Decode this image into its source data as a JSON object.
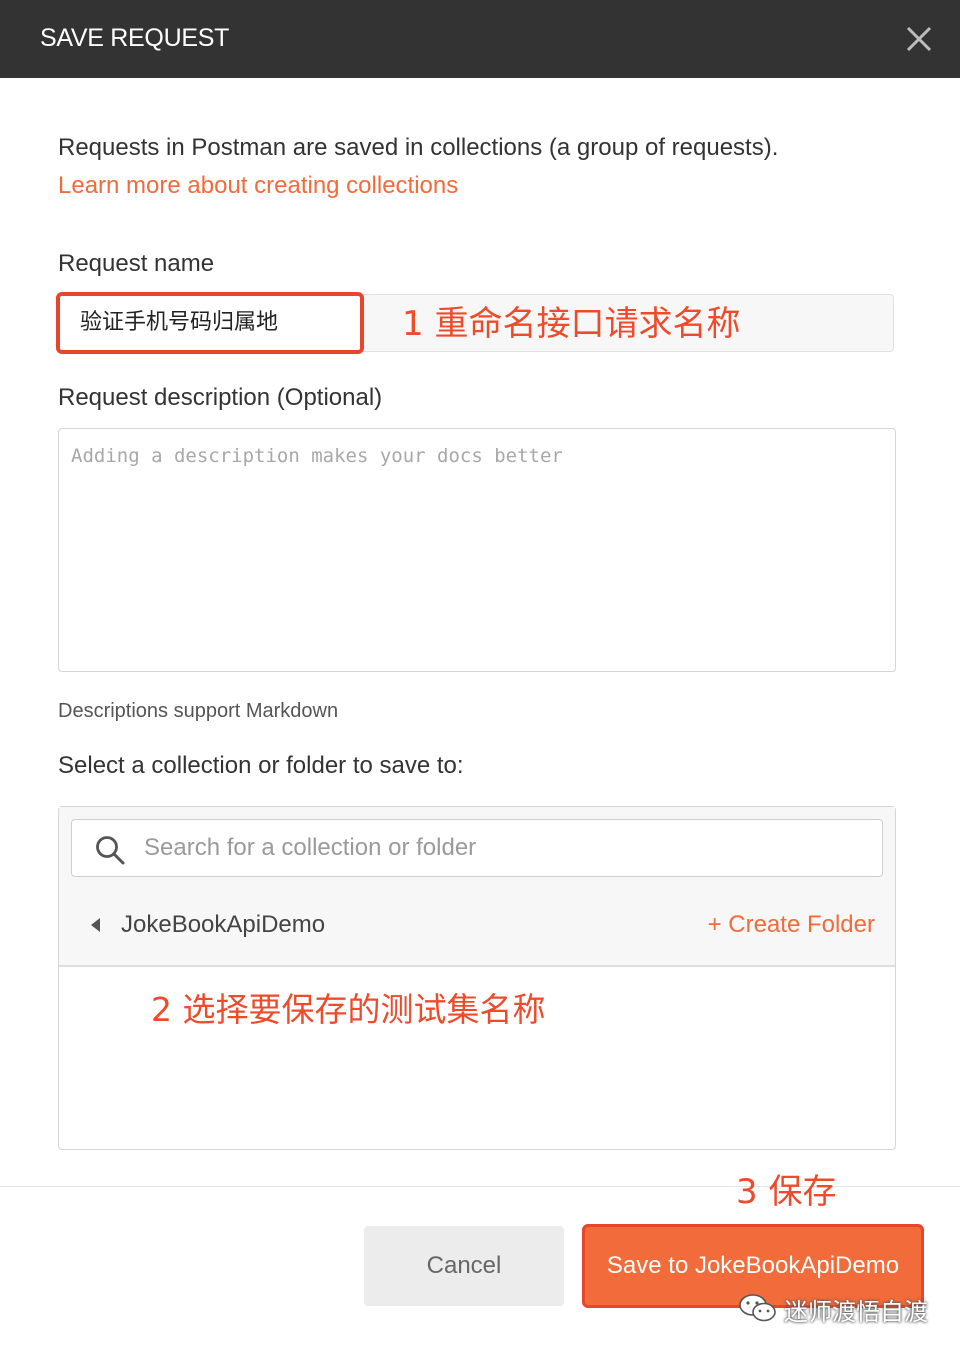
{
  "dialog": {
    "title": "SAVE REQUEST"
  },
  "intro": {
    "text": "Requests in Postman are saved in collections (a group of requests).",
    "link": "Learn more about creating collections"
  },
  "request_name": {
    "label": "Request name",
    "value": "验证手机号码归属地"
  },
  "request_description": {
    "label": "Request description (Optional)",
    "placeholder": "Adding a description makes your docs better",
    "note": "Descriptions support Markdown"
  },
  "collection": {
    "label": "Select a collection or folder to save to:",
    "search_placeholder": "Search for a collection or folder",
    "current": "JokeBookApiDemo",
    "create_folder": "+ Create Folder"
  },
  "buttons": {
    "cancel": "Cancel",
    "save": "Save to JokeBookApiDemo"
  },
  "annotations": {
    "step1": "1 重命名接口请求名称",
    "step2": "2 选择要保存的测试集名称",
    "step3": "3 保存"
  },
  "watermark": {
    "text": "迷师渡悟自渡"
  },
  "icons": {
    "close": "close-icon",
    "search": "search-icon",
    "caret": "caret-left-icon",
    "wechat": "wechat-logo-icon"
  },
  "colors": {
    "accent": "#f26b3a",
    "annotation": "#ee4b2b",
    "titlebar": "#333333"
  }
}
